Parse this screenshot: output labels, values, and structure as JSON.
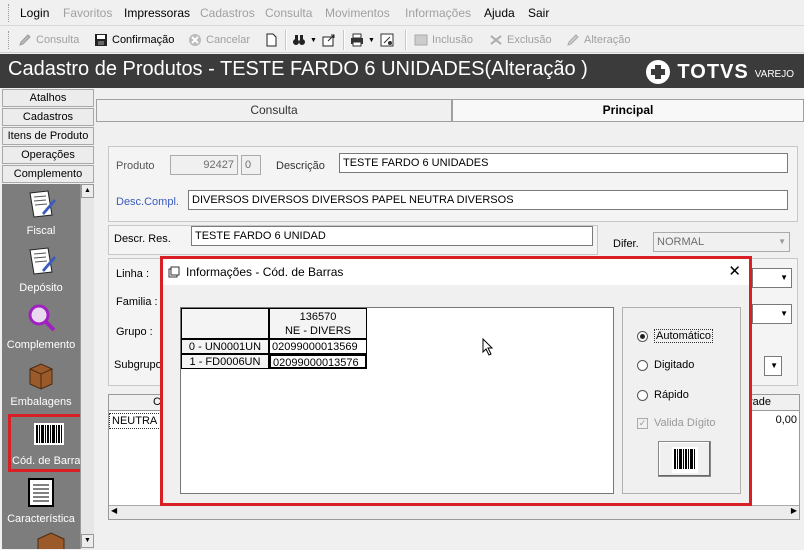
{
  "menu": [
    "Login",
    "Favoritos",
    "Impressoras",
    "Cadastros",
    "Consulta",
    "Movimentos",
    "Informações",
    "Ajuda",
    "Sair"
  ],
  "menu_disabled": [
    false,
    true,
    false,
    true,
    true,
    true,
    true,
    false,
    false
  ],
  "toolbar": {
    "consulta": "Consulta",
    "confirmacao": "Confirmação",
    "cancelar": "Cancelar",
    "inclusao": "Inclusão",
    "exclusao": "Exclusão",
    "alteracao": "Alteração"
  },
  "window_title": "Cadastro de Produtos  - TESTE FARDO 6 UNIDADES(Alteração )",
  "logo": {
    "brand": "TOTVS",
    "sub": "VAREJO"
  },
  "sidebar": {
    "buttons": [
      "Atalhos",
      "Cadastros",
      "Itens de Produto",
      "Operações",
      "Complemento"
    ],
    "items": [
      "Fiscal",
      "Depósito",
      "Complemento",
      "Embalagens",
      "Cód. de Barras",
      "Característica"
    ]
  },
  "tabs": {
    "consulta": "Consulta",
    "principal": "Principal"
  },
  "form": {
    "produto_label": "Produto",
    "produto_value": "92427",
    "produto_digit": "0",
    "descricao_label": "Descrição",
    "descricao_value": "TESTE FARDO 6 UNIDADES",
    "desc_compl_label": "Desc.Compl.",
    "desc_compl_value": "DIVERSOS DIVERSOS DIVERSOS PAPEL NEUTRA DIVERSOS",
    "descr_res_label": "Descr. Res.",
    "descr_res_value": "TESTE FARDO 6 UNIDAD",
    "difer_label": "Difer.",
    "difer_value": "NORMAL",
    "linha_label": "Linha :",
    "familia_label": "Familia :",
    "grupo_label": "Grupo :",
    "subgrupo_label": "Subgrupo",
    "grid_col_partial": "C",
    "grid_col_right_partial": "rade",
    "grid_cell_left": "NEUTRA",
    "grid_cell_right": "0,00"
  },
  "dialog": {
    "title": "Informações  - Cód. de Barras",
    "close": "✕",
    "header_line1": "136570",
    "header_line2": "NE - DIVERS",
    "rows": [
      {
        "label": "0 - UN0001UN",
        "barcode": "02099000013569"
      },
      {
        "label": "1 - FD0006UN",
        "barcode": "02099000013576"
      }
    ],
    "radios": [
      "Automático",
      "Digitado",
      "Rápido"
    ],
    "radio_selected": 0,
    "checkbox": "Valida Dígito"
  },
  "colors": {
    "highlight_red": "#d81f26",
    "titlebar": "#3b3b3b",
    "sidebar_panel": "#7d7d7d"
  }
}
